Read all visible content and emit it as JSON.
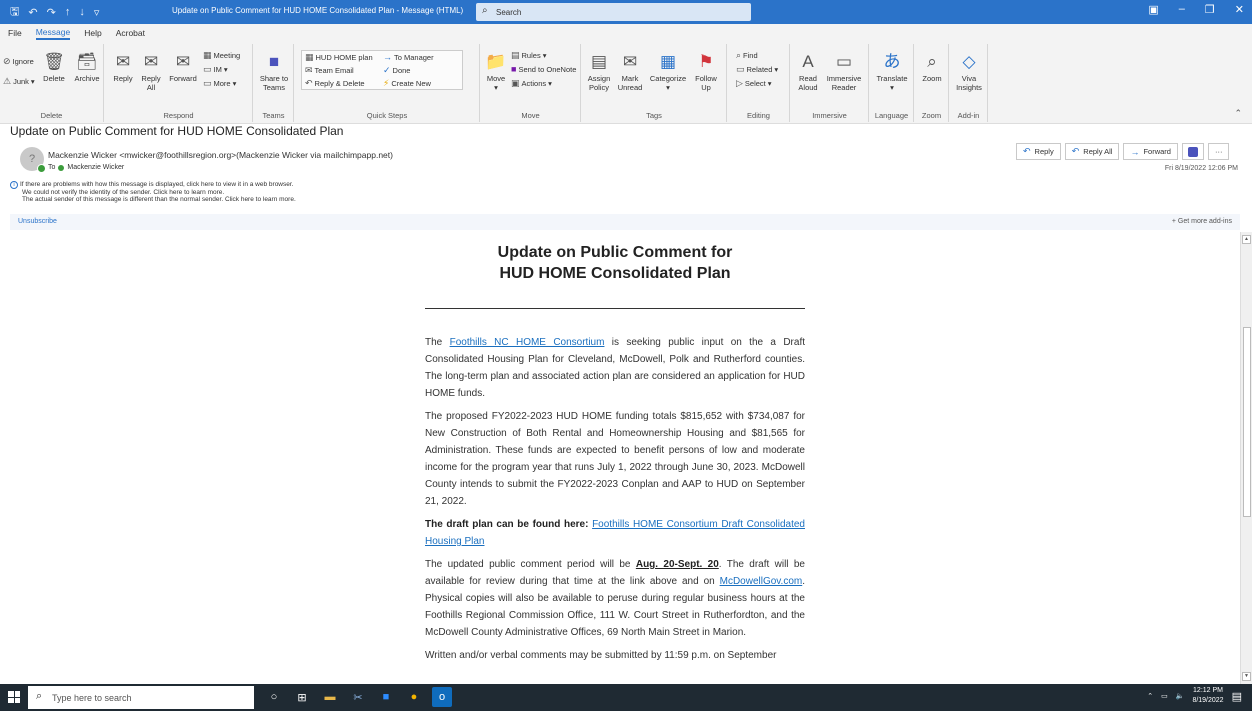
{
  "window": {
    "title": "Update on Public Comment for HUD HOME Consolidated Plan  -  Message (HTML)",
    "search_placeholder": "Search"
  },
  "menu": [
    "File",
    "Message",
    "Help",
    "Acrobat"
  ],
  "ribbon": {
    "delete_group": {
      "name": "Delete",
      "ignore": "Ignore",
      "junk": "Junk",
      "delete": "Delete",
      "archive": "Archive"
    },
    "respond_group": {
      "name": "Respond",
      "reply": "Reply",
      "reply_all_1": "Reply",
      "reply_all_2": "All",
      "forward": "Forward",
      "meeting": "Meeting",
      "im": "IM",
      "more": "More"
    },
    "teams_group": {
      "name": "Teams",
      "share_1": "Share to",
      "share_2": "Teams"
    },
    "quicksteps_group": {
      "name": "Quick Steps",
      "items": [
        "HUD HOME plan",
        "To Manager",
        "Team Email",
        "Done",
        "Reply & Delete",
        "Create New"
      ]
    },
    "move_group": {
      "name": "Move",
      "move": "Move",
      "rules": "Rules",
      "onenote": "Send to OneNote",
      "actions": "Actions"
    },
    "tags_group": {
      "name": "Tags",
      "assign_1": "Assign",
      "assign_2": "Policy",
      "mark_1": "Mark",
      "mark_2": "Unread",
      "categorize": "Categorize",
      "follow_1": "Follow",
      "follow_2": "Up"
    },
    "editing_group": {
      "name": "Editing",
      "find": "Find",
      "related": "Related",
      "select": "Select"
    },
    "immersive_group": {
      "name": "Immersive",
      "read_1": "Read",
      "read_2": "Aloud",
      "imm_1": "Immersive",
      "imm_2": "Reader"
    },
    "language_group": {
      "name": "Language",
      "translate": "Translate"
    },
    "zoom_group": {
      "name": "Zoom",
      "zoom": "Zoom"
    },
    "addin_group": {
      "name": "Add-in",
      "viva_1": "Viva",
      "viva_2": "Insights"
    }
  },
  "message": {
    "subject": "Update on Public Comment for HUD HOME Consolidated Plan",
    "sender": "Mackenzie Wicker <mwicker@foothillsregion.org>(Mackenzie Wicker via mailchimpapp.net)",
    "to_label": "To",
    "recipient": "Mackenzie Wicker",
    "info_lines": [
      "If there are problems with how this message is displayed, click here to view it in a web browser.",
      "We could not verify the identity of the sender. Click here to learn more.",
      "The actual sender of this message is different than the normal sender. Click here to learn more."
    ],
    "unsubscribe": "Unsubscribe",
    "get_addins": "Get more add-ins",
    "date": "Fri 8/19/2022 12:06 PM",
    "actions": {
      "reply": "Reply",
      "reply_all": "Reply All",
      "forward": "Forward"
    }
  },
  "email": {
    "title_line1": "Update on Public Comment for",
    "title_line2": "HUD HOME Consolidated Plan",
    "p1_pre": "The ",
    "p1_link": "Foothills NC HOME Consortium",
    "p1_post": " is seeking public input on the a Draft Consolidated Housing Plan for Cleveland, McDowell, Polk and Rutherford counties. The long-term plan and associated action plan are considered an application for HUD HOME funds.",
    "p2": "The proposed FY2022-2023 HUD HOME funding totals $815,652 with $734,087 for New Construction of Both Rental and Homeownership Housing and $81,565 for Administration. These funds are expected to benefit persons of low and moderate income for the program year that runs July 1, 2022 through June 30, 2023. McDowell County intends to submit the FY2022-2023 Conplan and AAP to HUD on September 21, 2022.",
    "p3_bold": "The draft plan can be found here:",
    "p3_link": "Foothills HOME Consortium Draft Consolidated Housing Plan",
    "p4_pre": "The updated public comment period will be ",
    "p4_bold": "Aug. 20-Sept. 20",
    "p4_mid": ". The draft will be available for review during that time at the link above and on ",
    "p4_link": "McDowellGov.com",
    "p4_post": ". Physical copies will also be available to peruse during regular business hours at the Foothills Regional Commission Office, 111 W. Court Street in Rutherfordton, and the McDowell County Administrative Offices, 69 North Main Street in Marion.",
    "p5": "Written and/or verbal comments may be submitted by 11:59 p.m. on September"
  },
  "taskbar": {
    "search_placeholder": "Type here to search",
    "time": "12:12 PM",
    "date": "8/19/2022"
  }
}
